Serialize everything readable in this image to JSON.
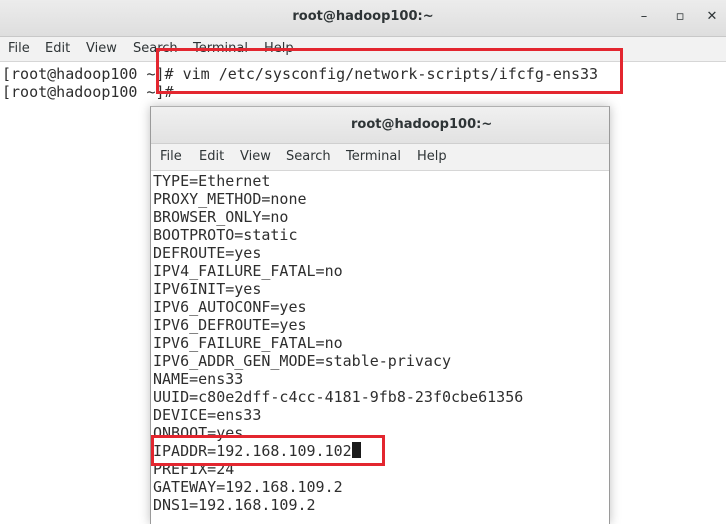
{
  "back_window": {
    "title": "root@hadoop100:~",
    "controls": {
      "minimize": "–",
      "maximize": "▫",
      "close": "✕"
    },
    "menu": [
      "File",
      "Edit",
      "View",
      "Search",
      "Terminal",
      "Help"
    ],
    "lines": [
      "[root@hadoop100 ~]# vim /etc/sysconfig/network-scripts/ifcfg-ens33",
      "[root@hadoop100 ~]#"
    ]
  },
  "front_window": {
    "title": "root@hadoop100:~",
    "menu": [
      "File",
      "Edit",
      "View",
      "Search",
      "Terminal",
      "Help"
    ],
    "lines": [
      "TYPE=Ethernet",
      "PROXY_METHOD=none",
      "BROWSER_ONLY=no",
      "BOOTPROTO=static",
      "DEFROUTE=yes",
      "IPV4_FAILURE_FATAL=no",
      "IPV6INIT=yes",
      "IPV6_AUTOCONF=yes",
      "IPV6_DEFROUTE=yes",
      "IPV6_FAILURE_FATAL=no",
      "IPV6_ADDR_GEN_MODE=stable-privacy",
      "NAME=ens33",
      "UUID=c80e2dff-c4cc-4181-9fb8-23f0cbe61356",
      "DEVICE=ens33",
      "ONBOOT=yes",
      "IPADDR=192.168.109.102",
      "PREFIX=24",
      "GATEWAY=192.168.109.2",
      "DNS1=192.168.109.2"
    ]
  },
  "colors": {
    "highlight": "#e3262f",
    "terminal_text": "#2e2e2e"
  }
}
